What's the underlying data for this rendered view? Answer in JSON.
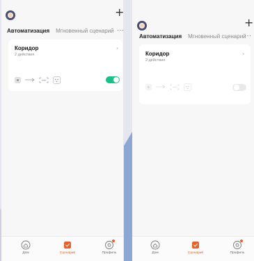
{
  "colors": {
    "accent": "#e8602c",
    "toggle_on": "#19c08a",
    "toggle_off": "#e9e9e9"
  },
  "screens": [
    {
      "tabs": {
        "active": "Автоматизация",
        "inactive": "Мгновенный сценарий"
      },
      "more_glyph": "···",
      "add_glyph": "+",
      "card": {
        "title": "Коридор",
        "subtitle": "2 действия",
        "chevron": "›",
        "enabled": true
      },
      "nav": {
        "home": "Дом",
        "scenarios": "Сценарий",
        "profile": "Профиль"
      }
    },
    {
      "tabs": {
        "active": "Автоматизация",
        "inactive": "Мгновенный сценарий"
      },
      "more_glyph": "···",
      "add_glyph": "+",
      "card": {
        "title": "Коридор",
        "subtitle": "2 действия",
        "chevron": "›",
        "enabled": false
      },
      "nav": {
        "home": "Дом",
        "scenarios": "Сценарий",
        "profile": "Профиль"
      }
    }
  ]
}
